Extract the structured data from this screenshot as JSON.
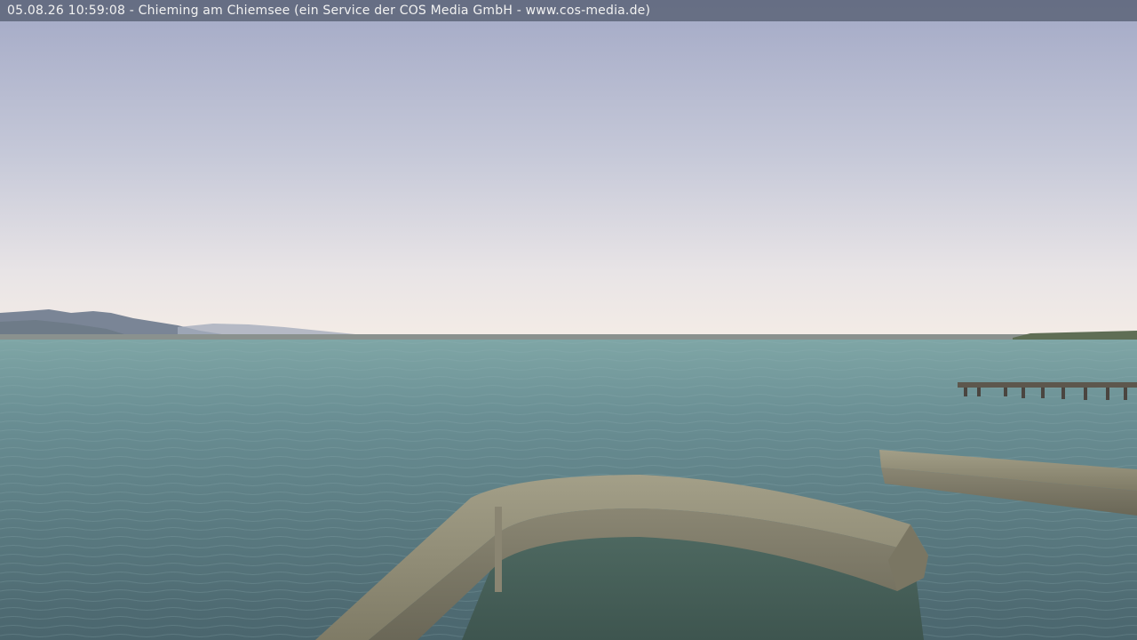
{
  "overlay": {
    "caption": "05.08.26 10:59:08 - Chieming am Chiemsee (ein Service der COS Media GmbH - www.cos-media.de)"
  },
  "scene": {
    "description_icon": "webcam-lake-view",
    "colors": {
      "sky_top": "#a6acc8",
      "sky_horizon": "#f4ece6",
      "water_far": "#6f9b9c",
      "water_near": "#4b6770",
      "mountains": "#7d8a9a",
      "pier_stone": "#8e8a76",
      "caption_bar": "#5c6478"
    }
  }
}
